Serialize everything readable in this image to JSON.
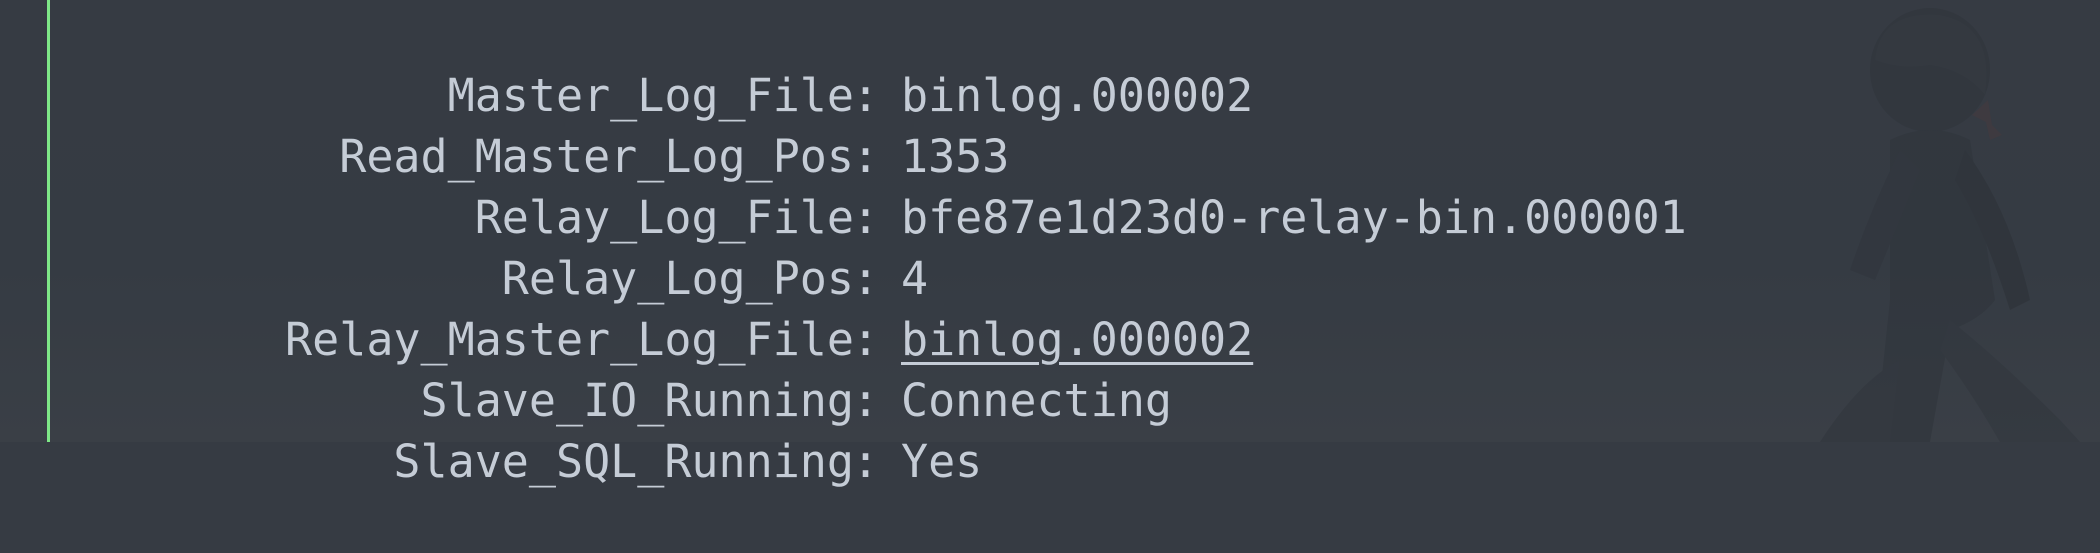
{
  "terminal": {
    "accent_bar_color": "#7ee787",
    "text_color": "#c5ccd6",
    "background_color": "#363b43",
    "rows": [
      {
        "key": "Master_Log_File",
        "value": "binlog.000002",
        "underlined": false
      },
      {
        "key": "Read_Master_Log_Pos",
        "value": "1353",
        "underlined": false
      },
      {
        "key": "Relay_Log_File",
        "value": "bfe87e1d23d0-relay-bin.000001",
        "underlined": false
      },
      {
        "key": "Relay_Log_Pos",
        "value": "4",
        "underlined": false
      },
      {
        "key": "Relay_Master_Log_File",
        "value": "binlog.000002",
        "underlined": true
      },
      {
        "key": "Slave_IO_Running",
        "value": "Connecting",
        "underlined": false
      },
      {
        "key": "Slave_SQL_Running",
        "value": "Yes",
        "underlined": false
      }
    ]
  }
}
